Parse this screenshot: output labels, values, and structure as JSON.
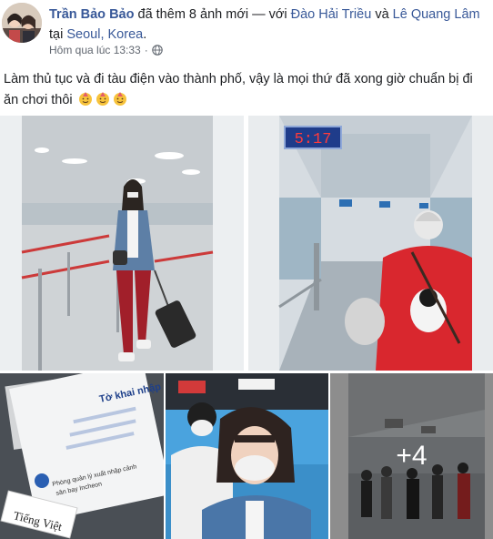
{
  "post": {
    "author": "Trần Bảo Bảo",
    "action": "đã thêm 8 ảnh mới — với",
    "tagged_1": "Đào Hải Triều",
    "and_word": "và",
    "tagged_2": "Lê Quang Lâm",
    "at_word": "tại",
    "location": "Seoul, Korea",
    "period": ".",
    "timestamp": "Hôm qua lúc 13:33",
    "privacy_icon": "globe-icon",
    "text": "Làm thủ tục và đi tàu điện vào thành phố, vậy là mọi thứ đã xong giờ chuẩn bị đi ăn chơi thôi",
    "text_emojis": [
      "partying-face-emoji",
      "partying-face-emoji",
      "partying-face-emoji"
    ]
  },
  "photos": {
    "clock_display": "5:17",
    "form_title": "Tờ khai nhập",
    "form_line_1": "Phòng quản lý xuất nhập cảnh",
    "form_line_2": "sân bay Incheon",
    "form_tab": "Tiếng Việt",
    "more_count": "+4"
  },
  "colors": {
    "link": "#385898",
    "meta": "#616770",
    "text": "#1c1e21"
  }
}
